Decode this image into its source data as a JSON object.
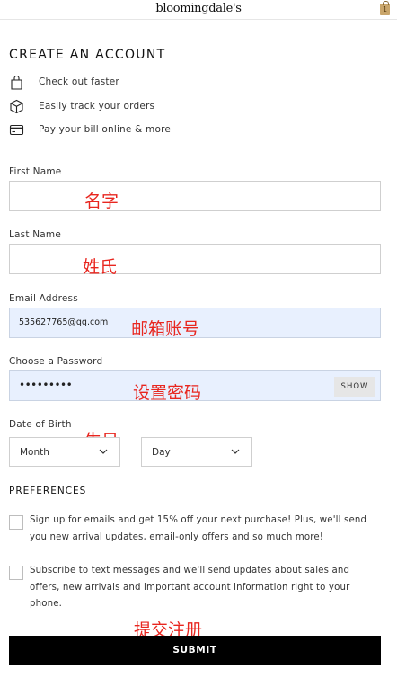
{
  "header": {
    "logo_text": "bloomingdale's",
    "bag_icon": "shopping-bag-icon",
    "bag_count": "1"
  },
  "page": {
    "title": "CREATE AN ACCOUNT"
  },
  "benefits": [
    {
      "icon": "shopping-bag-icon",
      "text": "Check out faster"
    },
    {
      "icon": "package-icon",
      "text": "Easily track your orders"
    },
    {
      "icon": "credit-card-icon",
      "text": "Pay your bill online & more"
    }
  ],
  "form": {
    "first_name": {
      "label": "First Name",
      "value": ""
    },
    "last_name": {
      "label": "Last Name",
      "value": ""
    },
    "email": {
      "label": "Email Address",
      "value": "535627765@qq.com"
    },
    "password": {
      "label": "Choose a Password",
      "masked_value": "•••••••••",
      "show_label": "SHOW"
    },
    "dob": {
      "label": "Date of Birth",
      "month": "Month",
      "day": "Day"
    }
  },
  "annotations": {
    "first_name": "名字",
    "last_name": "姓氏",
    "email": "邮箱账号",
    "password": "设置密码",
    "dob": "生日",
    "submit": "提交注册"
  },
  "preferences": {
    "title": "PREFERENCES",
    "email_optin": "Sign up for emails and get 15% off your next purchase! Plus, we'll send you new arrival updates, email-only offers and so much more!",
    "sms_optin": "Subscribe to text messages and we'll send updates about sales and offers, new arrivals and important account information right to your phone."
  },
  "submit": {
    "label": "SUBMIT"
  },
  "colors": {
    "annotation": "#e8261f",
    "autofill": "#e8f0fe",
    "button": "#000000"
  }
}
